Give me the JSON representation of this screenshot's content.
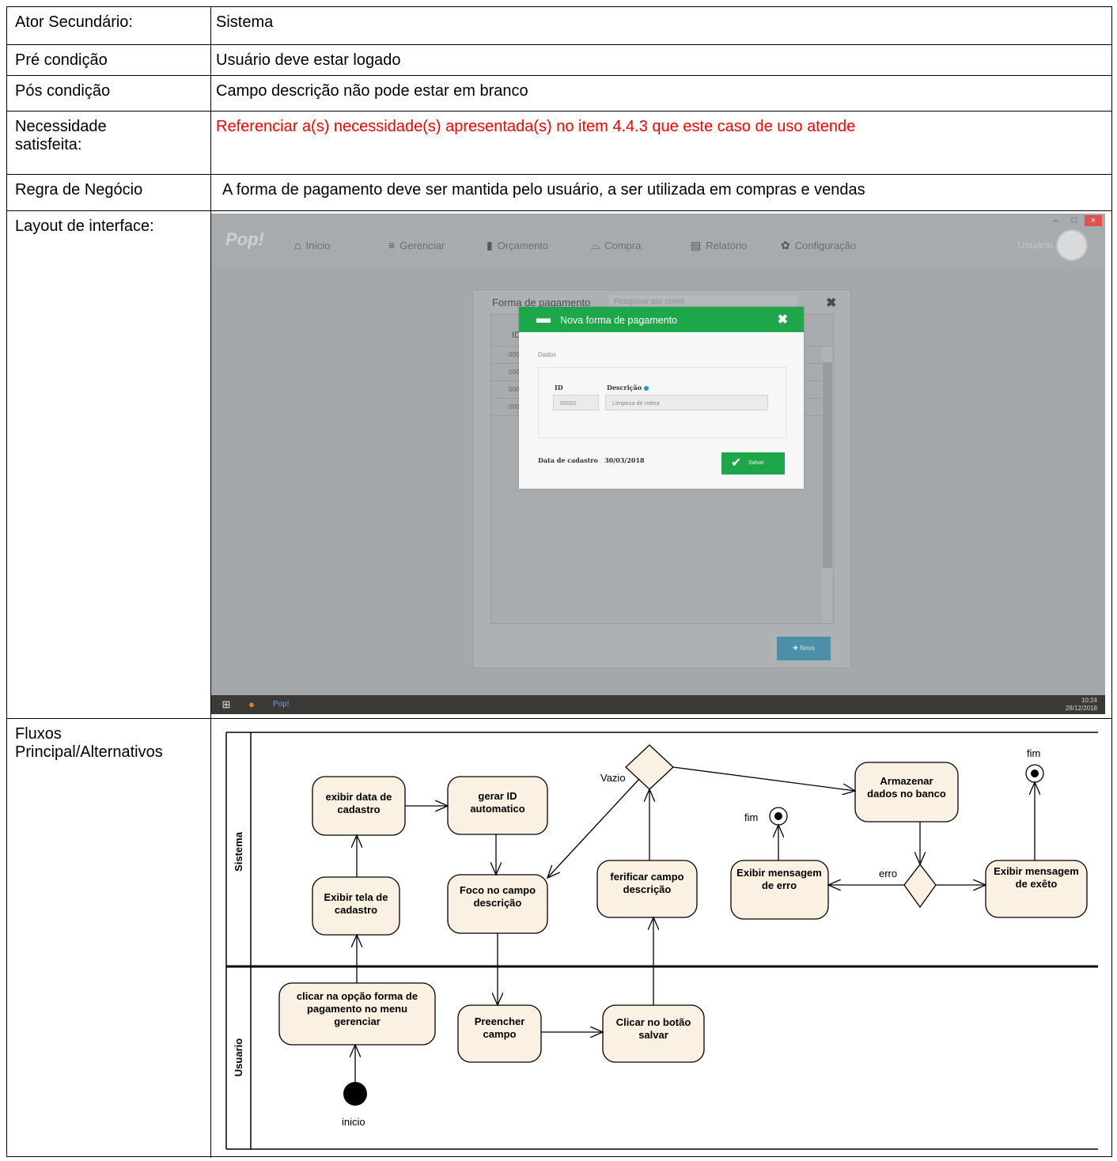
{
  "rows": [
    {
      "label": "Ator Secundário:",
      "value": "Sistema"
    },
    {
      "label": "Pré condição",
      "value": "Usuário deve estar logado"
    },
    {
      "label": "Pós condição",
      "value": "Campo descrição não pode estar em branco"
    },
    {
      "label": "Necessidade satisfeita:",
      "value": "Referenciar a(s) necessidade(s) apresentada(s) no item 4.4.3 que este caso de uso atende"
    },
    {
      "label": "Regra de Negócio",
      "value": "A forma de pagamento deve ser mantida pelo usuário, a ser utilizada em compras e vendas"
    },
    {
      "label": "Layout de interface:"
    },
    {
      "label": "Fluxos Principal/Alternativos"
    }
  ],
  "screenshot": {
    "logo": "Pop!",
    "nav": [
      {
        "label": "Início",
        "icon": "home-icon",
        "glyph": "⌂"
      },
      {
        "label": "Gerenciar",
        "icon": "database-icon",
        "glyph": "≡"
      },
      {
        "label": "Orçamento",
        "icon": "document-icon",
        "glyph": "▮"
      },
      {
        "label": "Compra",
        "icon": "basket-icon",
        "glyph": "⌓"
      },
      {
        "label": "Relatório",
        "icon": "report-icon",
        "glyph": "▤"
      },
      {
        "label": "Configuração",
        "icon": "gear-icon",
        "glyph": "✿"
      }
    ],
    "user_label": "Usuário",
    "panel": {
      "title": "Forma de pagamento",
      "search_placeholder": "Pesquisar por nome",
      "table_header": "ID",
      "rows": [
        "000",
        "000",
        "000",
        "000"
      ],
      "new_button": "Novo"
    },
    "modal": {
      "title": "Nova forma de pagamento",
      "section": "Dados",
      "id_label": "ID",
      "id_value": "00001",
      "desc_label": "Descrição",
      "desc_value": "Limpeza de rotina",
      "date_label": "Data de cadastro",
      "date_value": "30/03/2018",
      "save_button": "Salvar"
    },
    "taskbar": {
      "time": "10:24",
      "date": "28/12/2018"
    }
  },
  "diagram": {
    "lanes": [
      "Sistema",
      "Usuario"
    ],
    "nodes": {
      "exibir_data": "exibir data de cadastro",
      "gerar_id": "gerar ID automatico",
      "exibir_tela": "Exibir tela de cadastro",
      "foco": "Foco no campo descrição",
      "verificar": "ferificar campo descrição",
      "armazenar": "Armazenar dados no banco",
      "exibir_erro": "Exibir mensagem de erro",
      "exibir_exito": "Exibir mensagem de exêto",
      "clicar_opcao": "clicar na opção forma de pagamento no menu gerenciar",
      "preencher": "Preencher campo",
      "clicar_salvar": "Clicar no botão salvar"
    },
    "labels": {
      "vazio": "Vazio",
      "erro": "erro",
      "fim": "fim",
      "inicio": "inicio"
    }
  }
}
